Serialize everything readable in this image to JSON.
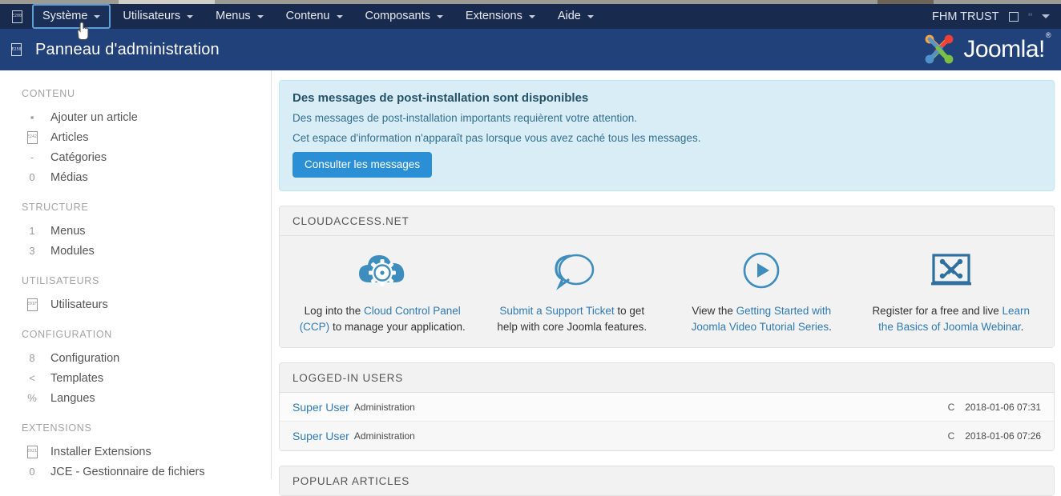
{
  "menubar": {
    "brand_icon": "joomla-tofu-icon",
    "brand_icon_glyph": "E200",
    "items": [
      {
        "label": "Système",
        "has_caret": true,
        "active": true
      },
      {
        "label": "Utilisateurs",
        "has_caret": true,
        "active": false
      },
      {
        "label": "Menus",
        "has_caret": true,
        "active": false
      },
      {
        "label": "Contenu",
        "has_caret": true,
        "active": false
      },
      {
        "label": "Composants",
        "has_caret": true,
        "active": false
      },
      {
        "label": "Extensions",
        "has_caret": true,
        "active": false
      },
      {
        "label": "Aide",
        "has_caret": true,
        "active": false
      }
    ],
    "site_name": "FHM TRUST",
    "site_icon": "external-link-icon",
    "notifications_icon": "quote-icon",
    "user_menu_icon": "chevron-down-icon"
  },
  "header": {
    "icon_glyph": "E250",
    "title": "Panneau d'administration",
    "logo_text": "Joomla!",
    "logo_sup": "®"
  },
  "sidebar": {
    "groups": [
      {
        "title": "CONTENU",
        "items": [
          {
            "icon": "plus-icon",
            "glyph": "+",
            "label": "Ajouter un article"
          },
          {
            "icon": "article-icon",
            "glyph": "E242",
            "label": "Articles"
          },
          {
            "icon": "folder-icon",
            "glyph": "-",
            "label": "Catégories"
          },
          {
            "icon": "images-icon",
            "glyph": "0",
            "label": "Médias"
          }
        ]
      },
      {
        "title": "STRUCTURE",
        "items": [
          {
            "icon": "menu-icon",
            "glyph": "1",
            "label": "Menus"
          },
          {
            "icon": "modules-icon",
            "glyph": "3",
            "label": "Modules"
          }
        ]
      },
      {
        "title": "UTILISATEURS",
        "items": [
          {
            "icon": "users-icon",
            "glyph": "E01F",
            "label": "Utilisateurs"
          }
        ]
      },
      {
        "title": "CONFIGURATION",
        "items": [
          {
            "icon": "cog-icon",
            "glyph": "8",
            "label": "Configuration"
          },
          {
            "icon": "paint-icon",
            "glyph": "<",
            "label": "Templates"
          },
          {
            "icon": "language-icon",
            "glyph": "%",
            "label": "Langues"
          }
        ]
      },
      {
        "title": "EXTENSIONS",
        "items": [
          {
            "icon": "puzzle-icon",
            "glyph": "E021",
            "label": "Installer Extensions"
          },
          {
            "icon": "file-icon",
            "glyph": "0",
            "label": "JCE - Gestionnaire de fichiers"
          }
        ]
      }
    ]
  },
  "alert": {
    "title": "Des messages de post-installation sont disponibles",
    "line1": "Des messages de post-installation importants requièrent votre attention.",
    "line2": "Cet espace d'information n'apparaît pas lorsque vous avez caché tous les messages.",
    "button": "Consulter les messages"
  },
  "cloudaccess": {
    "heading": "CLOUDACCESS.NET",
    "cells": [
      {
        "icon": "cloud-gear-icon",
        "text_before": "Log into the ",
        "link": "Cloud Control Panel (CCP)",
        "text_after": " to manage your application."
      },
      {
        "icon": "speech-bubbles-icon",
        "text_before": "",
        "link": "Submit a Support Ticket",
        "text_after": " to get help with core Joomla features."
      },
      {
        "icon": "play-circle-icon",
        "text_before": "View the ",
        "link": "Getting Started with Joomla Video Tutorial Series",
        "text_after": "."
      },
      {
        "icon": "joomla-monitor-icon",
        "text_before": "Register for a free and live ",
        "link": "Learn the Basics of Joomla Webinar",
        "text_after": "."
      }
    ]
  },
  "logged_in_users": {
    "heading": "LOGGED-IN USERS",
    "rows": [
      {
        "name": "Super User",
        "role": "Administration",
        "flag": "C",
        "time": "2018-01-06 07:31"
      },
      {
        "name": "Super User",
        "role": "Administration",
        "flag": "C",
        "time": "2018-01-06 07:26"
      }
    ]
  },
  "popular_articles": {
    "heading": "POPULAR ARTICLES"
  },
  "colors": {
    "menubar_bg": "#182a4e",
    "header_bg": "#20417a",
    "accent_blue": "#2a8fd4",
    "link_blue": "#2f7ab5",
    "alert_bg": "#d9edf7",
    "alert_border": "#bce8f1",
    "panel_bg": "#f2f2f2"
  }
}
